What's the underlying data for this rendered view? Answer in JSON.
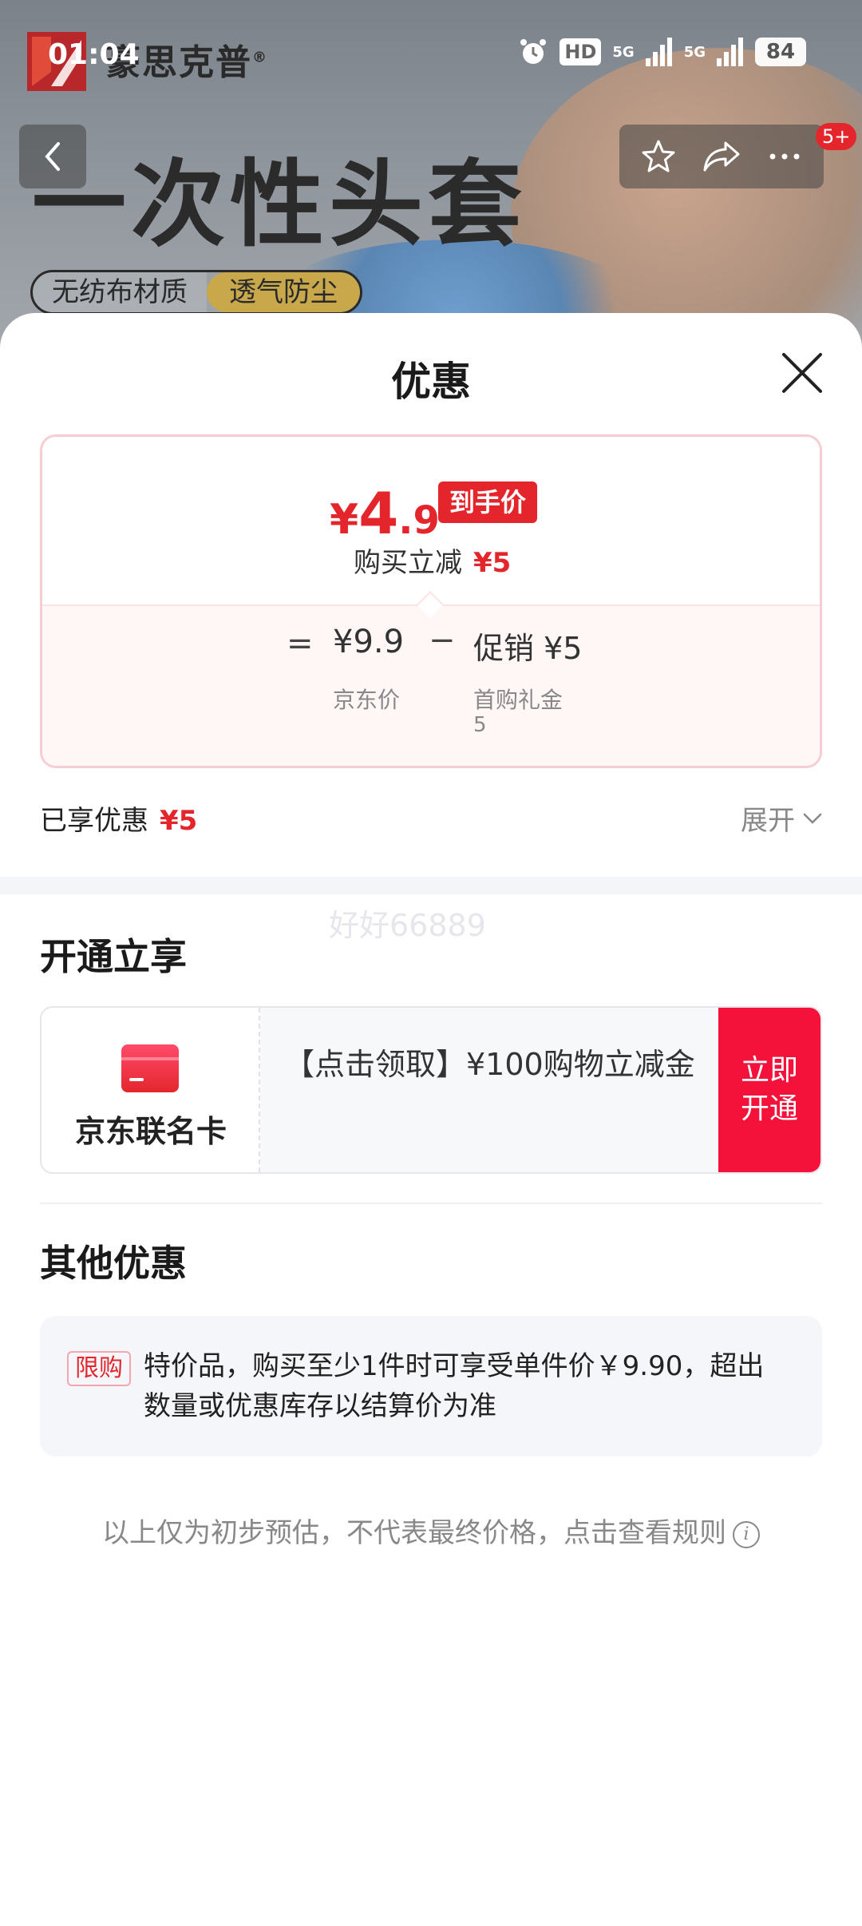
{
  "status_bar": {
    "time": "01:04",
    "hd_label": "HD",
    "net1": "5G",
    "net2": "5G",
    "battery": "84"
  },
  "product_bg": {
    "brand": "豪思克普",
    "brand_mark": "®",
    "title": "一次性头套",
    "tag1": "无纺布材质",
    "tag2": "透气防尘"
  },
  "nav": {
    "badge": "5+"
  },
  "sheet": {
    "title": "优惠"
  },
  "price_card": {
    "yen": "¥",
    "price_int": "4",
    "price_dec": ".9",
    "price_tag": "到手价",
    "sub_label": "购买立减",
    "sub_value": "¥5",
    "eq": "=",
    "jd_price": "¥9.9",
    "minus": "−",
    "promo_price": "促销 ¥5",
    "jd_price_label": "京东价",
    "promo_label": "首购礼金",
    "promo_sub": "5"
  },
  "enjoyed": {
    "label": "已享优惠",
    "value": "¥5",
    "expand": "展开"
  },
  "watermark": "好好66889",
  "open_section": {
    "title": "开通立享",
    "card_name": "京东联名卡",
    "card_desc": "【点击领取】¥100购物立减金",
    "button": "立即开通"
  },
  "other_section": {
    "title": "其他优惠",
    "tag": "限购",
    "text": "特价品，购买至少1件时可享受单件价￥9.90，超出数量或优惠库存以结算价为准"
  },
  "footer": {
    "note": "以上仅为初步预估，不代表最终价格，点击查看规则"
  },
  "colors": {
    "accent_red": "#e4262c",
    "button_red": "#f5123a"
  }
}
